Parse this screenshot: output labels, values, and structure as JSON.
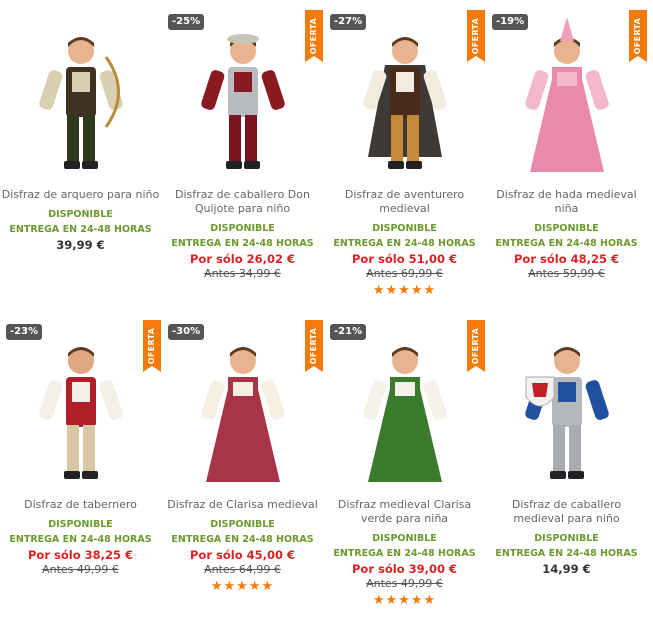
{
  "colors": {
    "available": "#6b9a2f",
    "offer_price": "#e02020",
    "ribbon": "#f47a0a",
    "badge": "#555555",
    "stars": "#f47a0a"
  },
  "products": [
    {
      "name": "Disfraz de arquero para niño",
      "available": "DISPONIBLE",
      "delivery": "ENTREGA EN 24-48 HORAS",
      "price": "39,99 €",
      "image_icon": "archer-costume-photo"
    },
    {
      "name": "Disfraz de caballero Don Quijote para niño",
      "discount": "-25%",
      "ribbon": "OFERTA",
      "available": "DISPONIBLE",
      "delivery": "ENTREGA EN 24-48 HORAS",
      "offer_price": "Por sólo 26,02 €",
      "old_price": "Antes 34,99 €",
      "image_icon": "knight-don-quijote-costume-photo"
    },
    {
      "name": "Disfraz de aventurero medieval",
      "discount": "-27%",
      "ribbon": "OFERTA",
      "available": "DISPONIBLE",
      "delivery": "ENTREGA EN 24-48 HORAS",
      "offer_price": "Por sólo 51,00 €",
      "old_price": "Antes 69,99 €",
      "stars": "★★★★★",
      "rating": 5,
      "image_icon": "adventurer-costume-photo"
    },
    {
      "name": "Disfraz de hada medieval niña",
      "discount": "-19%",
      "ribbon": "OFERTA",
      "available": "DISPONIBLE",
      "delivery": "ENTREGA EN 24-48 HORAS",
      "offer_price": "Por sólo 48,25 €",
      "old_price": "Antes 59,99 €",
      "image_icon": "fairy-costume-photo"
    },
    {
      "name": "Disfraz de tabernero",
      "discount": "-23%",
      "ribbon": "OFERTA",
      "available": "DISPONIBLE",
      "delivery": "ENTREGA EN 24-48 HORAS",
      "offer_price": "Por sólo 38,25 €",
      "old_price": "Antes 49,99 €",
      "image_icon": "innkeeper-costume-photo"
    },
    {
      "name": "Disfraz de Clarisa medieval",
      "discount": "-30%",
      "ribbon": "OFERTA",
      "available": "DISPONIBLE",
      "delivery": "ENTREGA EN 24-48 HORAS",
      "offer_price": "Por sólo 45,00 €",
      "old_price": "Antes 64,99 €",
      "stars": "★★★★★",
      "rating": 5,
      "image_icon": "clarisa-dress-costume-photo"
    },
    {
      "name": "Disfraz medieval Clarisa verde para niña",
      "discount": "-21%",
      "ribbon": "OFERTA",
      "available": "DISPONIBLE",
      "delivery": "ENTREGA EN 24-48 HORAS",
      "offer_price": "Por sólo 39,00 €",
      "old_price": "Antes 49,99 €",
      "stars": "★★★★★",
      "rating": 5,
      "image_icon": "green-clarisa-costume-photo"
    },
    {
      "name": "Disfraz de caballero medieval para niño",
      "available": "DISPONIBLE",
      "delivery": "ENTREGA EN 24-48 HORAS",
      "price": "14,99 €",
      "image_icon": "knight-costume-photo"
    }
  ]
}
